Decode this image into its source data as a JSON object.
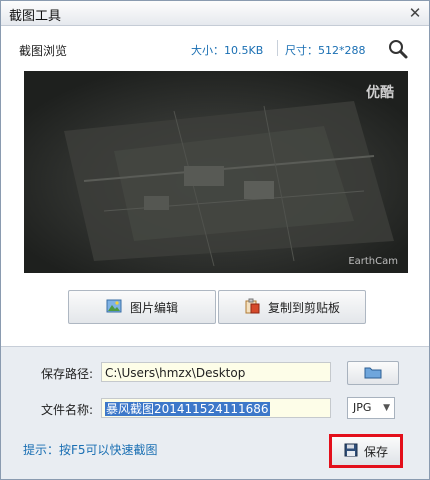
{
  "window": {
    "title": "截图工具",
    "close_icon": "close-icon"
  },
  "preview": {
    "label": "截图浏览",
    "size_text": "大小：10.5KB",
    "dim_text": "尺寸：512*288",
    "watermark_top": "优酷",
    "watermark_bottom": "EarthCam"
  },
  "actions": {
    "edit_label": "图片编辑",
    "copy_label": "复制到剪贴板"
  },
  "save": {
    "path_label": "保存路径:",
    "path_value": "C:\\Users\\hmzx\\Desktop",
    "name_label": "文件名称:",
    "name_value": "暴风截图201411524111686",
    "format": "JPG",
    "hint": "提示：按F5可以快速截图",
    "save_label": "保存"
  },
  "colors": {
    "accent": "#1a6fb3",
    "highlight": "#e30f1b"
  }
}
